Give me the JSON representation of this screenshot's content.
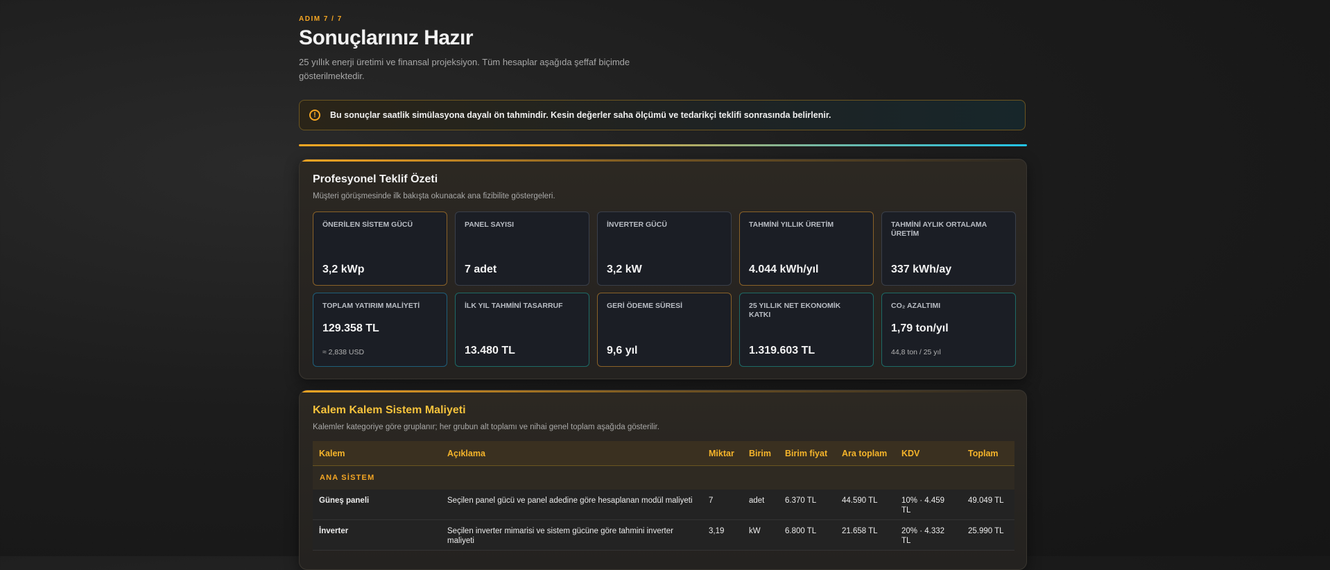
{
  "header": {
    "step": "ADIM 7 / 7",
    "title": "Sonuçlarınız Hazır",
    "subtitle": "25 yıllık enerji üretimi ve finansal projeksiyon. Tüm hesaplar aşağıda şeffaf biçimde gösterilmektedir."
  },
  "notice": {
    "icon": "warning-circle-icon",
    "text": "Bu sonuçlar saatlik simülasyona dayalı ön tahmindir. Kesin değerler saha ölçümü ve tedarikçi teklifi sonrasında belirlenir."
  },
  "summary": {
    "title": "Profesyonel Teklif Özeti",
    "subtitle": "Müşteri görüşmesinde ilk bakışta okunacak ana fizibilite göstergeleri.",
    "kpis": [
      {
        "label": "ÖNERİLEN SİSTEM GÜCÜ",
        "value": "3,2 kWp"
      },
      {
        "label": "PANEL SAYISI",
        "value": "7 adet"
      },
      {
        "label": "İNVERTER GÜCÜ",
        "value": "3,2 kW"
      },
      {
        "label": "TAHMİNİ YILLIK ÜRETİM",
        "value": "4.044 kWh/yıl"
      },
      {
        "label": "TAHMİNİ AYLIK ORTALAMA ÜRETİM",
        "value": "337 kWh/ay"
      },
      {
        "label": "TOPLAM YATIRIM MALİYETİ",
        "value": "129.358 TL",
        "note": "≈ 2,838 USD"
      },
      {
        "label": "İLK YIL TAHMİNİ TASARRUF",
        "value": "13.480 TL"
      },
      {
        "label": "GERİ ÖDEME SÜRESİ",
        "value": "9,6 yıl"
      },
      {
        "label": "25 YILLIK NET EKONOMİK KATKI",
        "value": "1.319.603 TL"
      },
      {
        "label": "CO₂ AZALTIMI",
        "value": "1,79 ton/yıl",
        "note": "44,8 ton / 25 yıl"
      }
    ]
  },
  "cost": {
    "title": "Kalem Kalem Sistem Maliyeti",
    "subtitle": "Kalemler kategoriye göre gruplanır; her grubun alt toplamı ve nihai genel toplam aşağıda gösterilir.",
    "columns": [
      "Kalem",
      "Açıklama",
      "Miktar",
      "Birim",
      "Birim fiyat",
      "Ara toplam",
      "KDV",
      "Toplam"
    ],
    "group": "ANA SİSTEM",
    "rows": [
      [
        "Güneş paneli",
        "Seçilen panel gücü ve panel adedine göre hesaplanan modül maliyeti",
        "7",
        "adet",
        "6.370 TL",
        "44.590 TL",
        "10% · 4.459 TL",
        "49.049 TL"
      ],
      [
        "İnverter",
        "Seçilen inverter mimarisi ve sistem gücüne göre tahmini inverter maliyeti",
        "3,19",
        "kW",
        "6.800 TL",
        "21.658 TL",
        "20% · 4.332 TL",
        "25.990 TL"
      ]
    ]
  },
  "colors": {
    "accent": "#f5a623",
    "cyan": "#22c3e6",
    "title_gold": "#f5c23c"
  }
}
